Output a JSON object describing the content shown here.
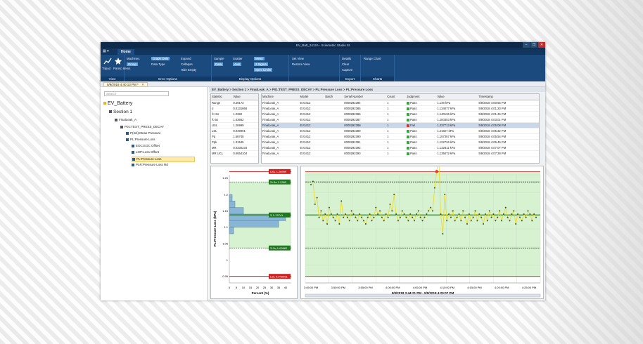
{
  "window": {
    "title": "EV_Batt_2412A - Sciemetric Studio SI",
    "controls": [
      "–",
      "❐",
      "✕"
    ]
  },
  "ribbon": {
    "app_tab": "▤ ▾",
    "home_tab": "Home",
    "groups": [
      {
        "name": "View",
        "buttons": [
          "Tripod",
          "Pareto Items"
        ]
      },
      {
        "name": "Error Options",
        "buttons": [
          "Machines",
          "Graph Only",
          "Group",
          "Data Type",
          "Expand",
          "Collapse",
          "Hide Empty"
        ]
      },
      {
        "name": "Display Options",
        "buttons": [
          "Sample",
          "Data",
          "Scatter",
          "Axis",
          "Mean",
          "3 Sigma",
          "Spec Limits"
        ]
      },
      {
        "name": "",
        "buttons": [
          "Set View",
          "Restore View"
        ]
      },
      {
        "name": "Export",
        "buttons": [
          "Details",
          "Clear",
          "Capture"
        ]
      },
      {
        "name": "Charts",
        "buttons": [
          "Range Chart"
        ]
      }
    ]
  },
  "doc_tab": {
    "label": "5/9/2018 4:40:13 PM *",
    "close": "✕"
  },
  "tree": {
    "search_placeholder": "Search",
    "nodes": [
      {
        "label": "EV_Battery",
        "level": 0
      },
      {
        "label": "Section 1",
        "level": 1
      },
      {
        "label": "FinalLeak_A",
        "level": 2
      },
      {
        "label": "P01:TEST_PRESS_DECAY",
        "level": 3
      },
      {
        "label": "P(Init):Meas Pressure",
        "level": 4
      },
      {
        "label": "PL:Pressure Loss",
        "level": 4
      },
      {
        "label": "EOC:EOC Offset",
        "level": 5
      },
      {
        "label": "LOP:Loss Offset",
        "level": 5
      },
      {
        "label": "PL:Pressure Loss",
        "level": 5,
        "selected": true
      },
      {
        "label": "PLR:Pressure Loss Rd",
        "level": 5
      }
    ]
  },
  "breadcrumb": "EV_Battery > Section 1 > FinalLeak_A > P01:TEST_PRESS_DECAY > PL:Pressure Loss > PL:Pressure Loss",
  "stats": {
    "headers": [
      "Statistic",
      "Value"
    ],
    "rows": [
      [
        "Range",
        "0.29173"
      ],
      [
        "σ",
        "0.0131866"
      ],
      [
        "X̄+3σ",
        "1.2382"
      ],
      [
        "X̄-3σ",
        "1.03662"
      ],
      [
        "USL",
        "1.26999"
      ],
      [
        "LSL",
        "0.949991"
      ],
      [
        "Pp",
        "1.58748"
      ],
      [
        "Ppk",
        "1.31545"
      ],
      [
        "MR",
        "0.0330234"
      ],
      [
        "MR UCL",
        "0.0654104"
      ]
    ]
  },
  "data_table": {
    "headers": [
      "Machine",
      "Model",
      "Batch",
      "Serial Number",
      "Count",
      "Judgment",
      "Value",
      "Timestamp"
    ],
    "rows": [
      [
        "FinalLeak_A",
        "EV3412",
        "",
        "0000292384",
        "1",
        "Pass",
        "1.146 kPa",
        "5/9/2018 4:00:55 PM"
      ],
      [
        "FinalLeak_A",
        "EV3412",
        "",
        "0000292385",
        "1",
        "Pass",
        "1.134077 kPa",
        "5/9/2018 4:01:23 PM"
      ],
      [
        "FinalLeak_A",
        "EV3412",
        "",
        "0000292386",
        "1",
        "Pass",
        "1.140136 kPa",
        "5/9/2018 4:01:45 PM"
      ],
      [
        "FinalLeak_A",
        "EV3412",
        "",
        "0000292387",
        "1",
        "Pass",
        "1.200303 kPa",
        "5/9/2018 4:03:01 PM"
      ],
      [
        "FinalLeak_A",
        "EV3412",
        "",
        "0000292388",
        "1",
        "Fail",
        "1.337713 kPa",
        "5/9/2018 4:05:08 PM"
      ],
      [
        "FinalLeak_A",
        "EV3412",
        "",
        "0000292389",
        "1",
        "Pass",
        "1.21827 kPa",
        "5/9/2018 4:05:32 PM"
      ],
      [
        "FinalLeak_A",
        "EV3412",
        "",
        "0000292390",
        "1",
        "Pass",
        "1.157357 kPa",
        "5/9/2018 4:05:54 PM"
      ],
      [
        "FinalLeak_A",
        "EV3412",
        "",
        "0000292391",
        "1",
        "Pass",
        "1.122726 kPa",
        "5/9/2018 4:06:46 PM"
      ],
      [
        "FinalLeak_A",
        "EV3412",
        "",
        "0000292392",
        "1",
        "Pass",
        "1.132811 kPa",
        "5/9/2018 4:07:07 PM"
      ],
      [
        "FinalLeak_A",
        "EV3412",
        "",
        "0000292393",
        "1",
        "Pass",
        "1.135072 kPa",
        "5/9/2018 4:07:28 PM"
      ]
    ],
    "selected_row": 4
  },
  "colors": {
    "ribbon": "#1b4a7e",
    "title": "#0d2a4a",
    "zone": "#d6f2d0",
    "spec": "#cc2222",
    "mean": "#227722",
    "line": "#f2d91b",
    "hist": "#8ab6d6"
  },
  "chart_data": [
    {
      "type": "bar",
      "orientation": "horizontal",
      "xlabel": "Percent (%)",
      "ylabel": "PL:Pressure Loss (kPa)",
      "xticks": [
        "0",
        "5",
        "10",
        "15",
        "20",
        "25",
        "30",
        "35",
        "40"
      ],
      "xlim": [
        0,
        44
      ],
      "yticks": [
        "0.95",
        "1",
        "1.05",
        "1.1",
        "1.15",
        "1.2",
        "1.25"
      ],
      "ylim": [
        0.93,
        1.26
      ],
      "bins": [
        {
          "lo": 1.14,
          "hi": 1.16,
          "value": 10
        },
        {
          "lo": 1.12,
          "hi": 1.14,
          "value": 40
        },
        {
          "lo": 1.1,
          "hi": 1.12,
          "value": 35
        },
        {
          "lo": 1.16,
          "hi": 1.18,
          "value": 4
        },
        {
          "lo": 1.18,
          "hi": 1.2,
          "value": 2
        },
        {
          "lo": 1.08,
          "hi": 1.1,
          "value": 3
        }
      ],
      "annotations": [
        {
          "label": "USL 1.26999",
          "value": 1.26999,
          "color": "#cc2222"
        },
        {
          "label": "X̄+3σ 1.2382",
          "value": 1.2382,
          "color": "#227722"
        },
        {
          "label": "X̄ 1.13741",
          "value": 1.13741,
          "color": "#227722"
        },
        {
          "label": "X̄-3σ 1.03662",
          "value": 1.03662,
          "color": "#227722"
        },
        {
          "label": "LSL 0.949991",
          "value": 0.949991,
          "color": "#cc2222"
        }
      ]
    },
    {
      "type": "line",
      "xlabel": "5/9/2018 3:44:21 PM - 5/9/2018 4:29:07 PM",
      "xticks": [
        "3:45:00 PM",
        "3:50:00 PM",
        "3:55:00 PM",
        "4:00:00 PM",
        "4:05:00 PM",
        "4:10:00 PM",
        "4:15:00 PM",
        "4:20:00 PM",
        "4:25:00 PM"
      ],
      "ylim": [
        0.93,
        1.26
      ],
      "usl": 1.26999,
      "lsl": 0.949991,
      "ucl": 1.2382,
      "lcl": 1.03662,
      "mean": 1.13741,
      "y": [
        1.23,
        1.24,
        1.17,
        1.19,
        1.13,
        1.15,
        1.12,
        1.14,
        1.11,
        1.16,
        1.14,
        1.13,
        1.12,
        1.14,
        1.11,
        1.18,
        1.13,
        1.14,
        1.13,
        1.12,
        1.15,
        1.14,
        1.13,
        1.12,
        1.14,
        1.13,
        1.12,
        1.11,
        1.13,
        1.14,
        1.12,
        1.13,
        1.16,
        1.14,
        1.15,
        1.13,
        1.12,
        1.14,
        1.13,
        1.17,
        1.15,
        1.2,
        1.14,
        1.12,
        1.13,
        1.15,
        1.14,
        1.13,
        1.12,
        1.14,
        1.13,
        1.12,
        1.14,
        1.15,
        1.13,
        1.12,
        1.13,
        1.14,
        1.15,
        1.16,
        1.15,
        1.22,
        1.27,
        1.32,
        1.14,
        1.08,
        1.2,
        1.12,
        1.14,
        1.13,
        1.15,
        1.12,
        1.13,
        1.14,
        1.12,
        1.15,
        1.13,
        1.11,
        1.14,
        1.12,
        1.13,
        1.15,
        1.12,
        1.14,
        1.13,
        1.11,
        1.14,
        1.12,
        1.15,
        1.13,
        1.14,
        1.12,
        1.13,
        1.15,
        1.12,
        1.14,
        1.16,
        1.13,
        1.12,
        1.14,
        1.15,
        1.11,
        1.14,
        1.13,
        1.12,
        1.14,
        1.13,
        1.15,
        1.14,
        1.12,
        1.14,
        1.13
      ]
    }
  ]
}
